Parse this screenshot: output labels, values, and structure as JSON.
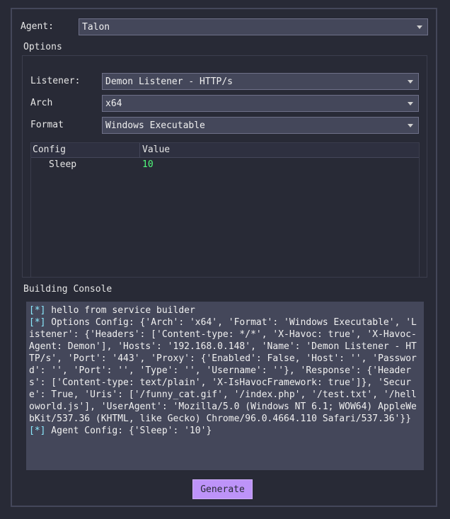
{
  "agent": {
    "label": "Agent:",
    "value": "Talon"
  },
  "options": {
    "title": "Options",
    "listener": {
      "label": "Listener:",
      "value": "Demon Listener - HTTP/s"
    },
    "arch": {
      "label": "Arch",
      "value": "x64"
    },
    "format": {
      "label": "Format",
      "value": "Windows Executable"
    },
    "table": {
      "headers": [
        "Config",
        "Value"
      ],
      "rows": [
        {
          "config": "Sleep",
          "value": "10"
        }
      ]
    }
  },
  "console": {
    "title": "Building Console",
    "lines": [
      {
        "tag": "[*]",
        "text": " hello from service builder"
      },
      {
        "tag": "[*]",
        "text": " Options Config: {'Arch': 'x64', 'Format': 'Windows Executable', 'Listener': {'Headers': ['Content-type: */*', 'X-Havoc: true', 'X-Havoc-Agent: Demon'], 'Hosts': '192.168.0.148', 'Name': 'Demon Listener - HTTP/s', 'Port': '443', 'Proxy': {'Enabled': False, 'Host': '', 'Password': '', 'Port': '', 'Type': '', 'Username': ''}, 'Response': {'Headers': ['Content-type: text/plain', 'X-IsHavocFramework: true']}, 'Secure': True, 'Uris': ['/funny_cat.gif', '/index.php', '/test.txt', '/helloworld.js'], 'UserAgent': 'Mozilla/5.0 (Windows NT 6.1; WOW64) AppleWebKit/537.36 (KHTML, like Gecko) Chrome/96.0.4664.110 Safari/537.36'}}"
      },
      {
        "tag": "[*]",
        "text": " Agent Config: {'Sleep': '10'}"
      }
    ]
  },
  "generate_label": "Generate",
  "colors": {
    "background": "#282a36",
    "input": "#44475a",
    "accent": "#bd93f9",
    "value_green": "#50fa7b",
    "tag_cyan": "#8be9fd"
  }
}
